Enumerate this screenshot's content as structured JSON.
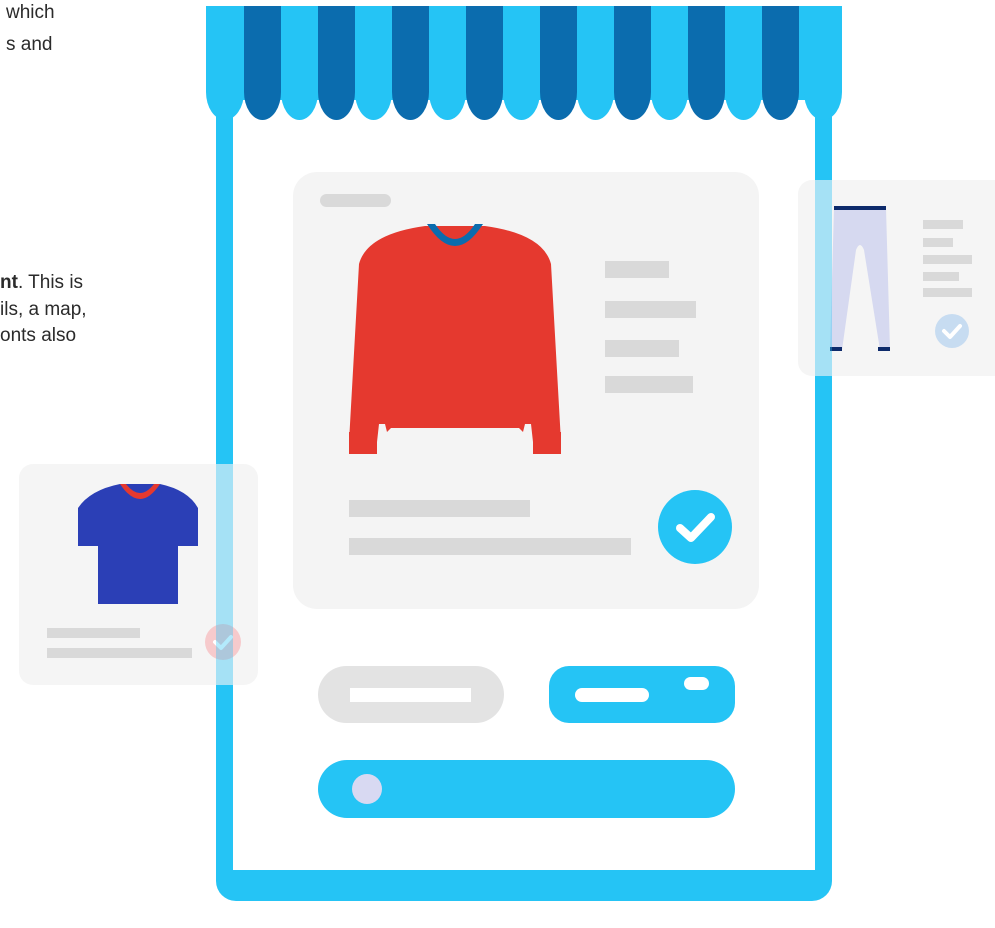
{
  "intro": {
    "line1": "which",
    "line2": "s and",
    "line3_bold": "nt",
    "line3_rest": ". This is",
    "line4": "ils, a map,",
    "line5": "onts also"
  },
  "icons": {
    "awning": "striped-awning-icon",
    "sweater": "sweater-icon",
    "tshirt": "tshirt-icon",
    "trousers": "trousers-icon",
    "check": "checkmark-icon"
  },
  "colors": {
    "phone_blue": "#25c4f5",
    "awning_dark": "#0b6cae",
    "sweater_red": "#e5392f",
    "tshirt_blue": "#2b3fb6",
    "trousers_lavender": "#d6d9f0",
    "card_grey": "#f4f4f4",
    "placeholder_grey": "#d9d9d9"
  }
}
